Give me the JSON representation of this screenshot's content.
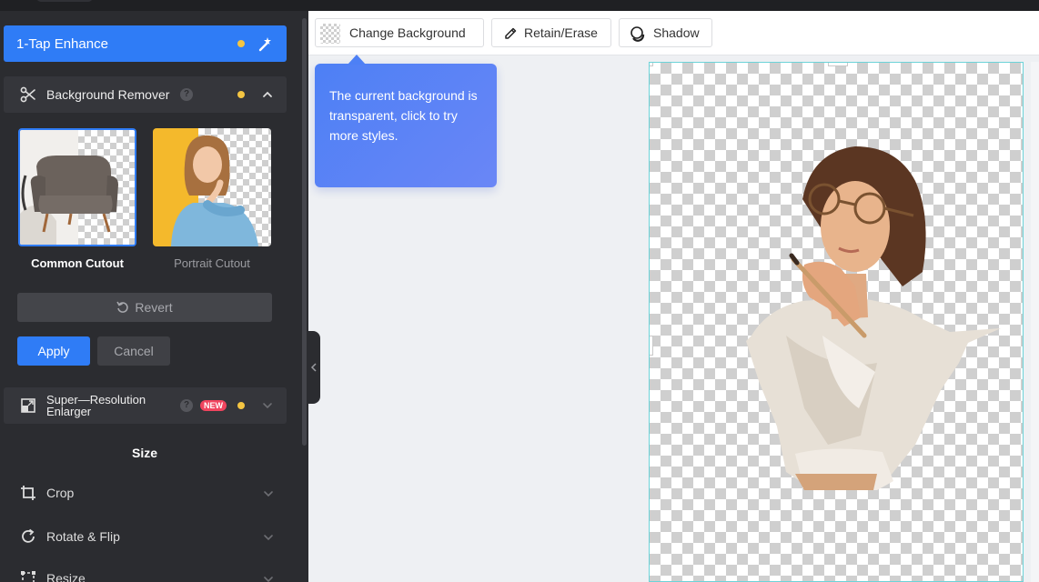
{
  "sidebar": {
    "enhance_label": "1-Tap Enhance",
    "bg_remover": {
      "label": "Background Remover",
      "help": "?",
      "options": [
        {
          "label": "Common Cutout",
          "selected": true
        },
        {
          "label": "Portrait Cutout",
          "selected": false
        }
      ],
      "revert_label": "Revert",
      "apply_label": "Apply",
      "cancel_label": "Cancel"
    },
    "super_resolution": {
      "label": "Super—Resolution Enlarger",
      "help": "?",
      "badge": "NEW"
    },
    "size_title": "Size",
    "size_items": [
      {
        "label": "Crop",
        "icon": "crop-icon"
      },
      {
        "label": "Rotate & Flip",
        "icon": "rotate-icon"
      },
      {
        "label": "Resize",
        "icon": "resize-icon"
      }
    ]
  },
  "toolbar": {
    "change_background": "Change Background",
    "retain_erase": "Retain/Erase",
    "shadow": "Shadow"
  },
  "tooltip": {
    "text": "The current background is transparent, click to try more styles."
  },
  "colors": {
    "accent": "#2f7cf6",
    "sidebar_bg": "#2b2c30",
    "dot": "#f4c542",
    "new_badge": "#f0445e",
    "canvas_border": "#6cd3d8"
  }
}
